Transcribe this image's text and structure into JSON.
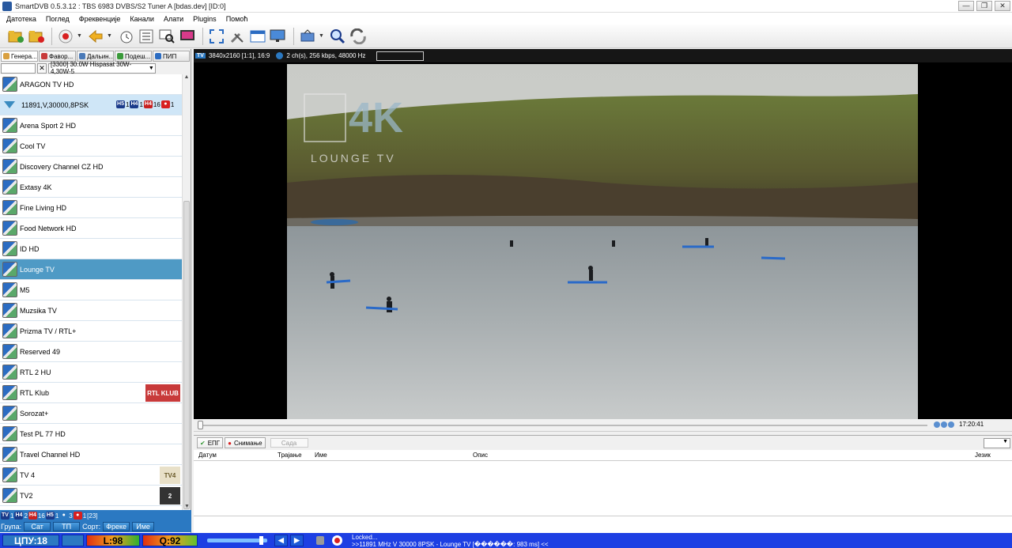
{
  "window": {
    "title": "SmartDVB 0.5.3.12 : TBS 6983 DVBS/S2 Tuner A [bdas.dev]  [ID:0]",
    "controls": [
      "—",
      "❐",
      "✕"
    ]
  },
  "menu": [
    "Датотека",
    "Поглед",
    "Фреквенције",
    "Канали",
    "Алати",
    "Plugins",
    "Помоћ"
  ],
  "toolbar": [
    "folder-add-icon",
    "folder-remove-icon",
    "record-icon",
    "back-icon",
    "timer-icon",
    "list-icon",
    "search-screen-icon",
    "monitor-icon",
    "fullscreen-icon",
    "tools-icon",
    "window-icon",
    "display-icon",
    "channels-icon",
    "zoom-icon",
    "refresh-icon"
  ],
  "left_tabs": [
    {
      "label": "Генера...",
      "color": "#d9a040"
    },
    {
      "label": "Фавор...",
      "color": "#c83a3a"
    },
    {
      "label": "Дальин...",
      "color": "#4a7ab8"
    },
    {
      "label": "Подеш...",
      "color": "#3a9a3a"
    },
    {
      "label": "ПИП",
      "color": "#2b6cc2"
    }
  ],
  "filter": {
    "x": "✕",
    "satellite": "[3300] 30.0W  Hispasat 30W-4,30W-5"
  },
  "transponder": {
    "label": "11891,V,30000,8PSK",
    "badges": [
      {
        "t": "H5",
        "c": "#1a3a8a"
      },
      {
        "t": "1",
        "c": ""
      },
      {
        "t": "H4",
        "c": "#1a3a8a"
      },
      {
        "t": "1",
        "c": ""
      },
      {
        "t": "H4",
        "c": "#c82020"
      },
      {
        "t": "16",
        "c": ""
      },
      {
        "t": "●",
        "c": "#d82020"
      },
      {
        "t": "1",
        "c": ""
      }
    ]
  },
  "channels": [
    {
      "name": "ARAGON TV HD",
      "icon": "channel-icon"
    },
    {
      "name": "Arena Sport 2 HD",
      "icon": "channel-icon"
    },
    {
      "name": "Cool TV",
      "icon": "channel-icon"
    },
    {
      "name": "Discovery Channel CZ HD",
      "icon": "channel-icon"
    },
    {
      "name": "Extasy 4K",
      "icon": "channel-icon"
    },
    {
      "name": "Fine Living HD",
      "icon": "channel-icon"
    },
    {
      "name": "Food Network HD",
      "icon": "channel-icon"
    },
    {
      "name": "ID HD",
      "icon": "channel-icon"
    },
    {
      "name": "Lounge TV",
      "icon": "channel-icon",
      "selected": true
    },
    {
      "name": "M5",
      "icon": "channel-icon"
    },
    {
      "name": "Muzsika TV",
      "icon": "channel-icon"
    },
    {
      "name": "Prizma TV / RTL+",
      "icon": "channel-icon"
    },
    {
      "name": "Reserved 49",
      "icon": "channel-icon"
    },
    {
      "name": "RTL 2 HU",
      "icon": "channel-icon"
    },
    {
      "name": "RTL Klub",
      "icon": "channel-icon",
      "logo": "RTL KLUB"
    },
    {
      "name": "Sorozat+",
      "icon": "channel-icon"
    },
    {
      "name": "Test PL 77  HD",
      "icon": "channel-icon"
    },
    {
      "name": "Travel Channel HD",
      "icon": "channel-icon"
    },
    {
      "name": "TV 4",
      "icon": "channel-icon",
      "logo": "TV4"
    },
    {
      "name": "TV2",
      "icon": "channel-icon",
      "logo": "2"
    }
  ],
  "status_counts": [
    {
      "t": "TV",
      "c": "#1a3a8a"
    },
    {
      "t": "1",
      "c": ""
    },
    {
      "t": "H4",
      "c": "#1a3a8a"
    },
    {
      "t": "2",
      "c": ""
    },
    {
      "t": "H4",
      "c": "#c82020"
    },
    {
      "t": "16",
      "c": ""
    },
    {
      "t": "H5",
      "c": "#1a3a8a"
    },
    {
      "t": "1",
      "c": ""
    },
    {
      "t": "●",
      "c": "#2b79c2"
    },
    {
      "t": "3",
      "c": ""
    },
    {
      "t": "●",
      "c": "#d82020"
    },
    {
      "t": "1",
      "c": ""
    },
    {
      "t": "[23]",
      "c": ""
    }
  ],
  "group": {
    "label": "Група:",
    "sat": "Сат",
    "tp": "ТП",
    "sort_label": "Сорт:",
    "freq": "Фреке",
    "name": "Име"
  },
  "video": {
    "info": "3840x2160 [1:1], 16:9",
    "audio": "2 ch(s), 256 kbps, 48000 Hz",
    "logo_big": "4K",
    "logo_sub": "LOUNGE TV"
  },
  "seek": {
    "time": "17:20:41"
  },
  "epg": {
    "tab_epg": "ЕПГ",
    "tab_rec": "Снимање",
    "now_btn": "Сада",
    "cols": {
      "date": "Датум",
      "duration": "Трајање",
      "name": "Име",
      "desc": "Опис",
      "lang": "Језик"
    }
  },
  "bottom": {
    "cpu": "ЦПУ:18",
    "level": "L:98",
    "quality": "Q:92",
    "status1": "Locked...",
    "status2": ">>11891 MHz V 30000 8PSK - Lounge TV [������: 983 ms] <<"
  }
}
